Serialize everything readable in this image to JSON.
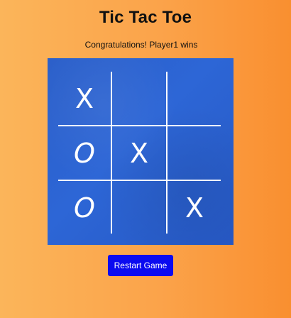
{
  "game": {
    "title": "Tic Tac Toe",
    "status": "Congratulations! Player1 wins",
    "board": [
      [
        "X",
        "",
        ""
      ],
      [
        "O",
        "X",
        ""
      ],
      [
        "O",
        "",
        "X"
      ]
    ],
    "restart_label": "Restart Game"
  },
  "colors": {
    "board": "#2d66d6",
    "marks": "#ffffff",
    "button": "#0b0bf0",
    "background_start": "#fbb55a",
    "background_end": "#f98f30"
  }
}
